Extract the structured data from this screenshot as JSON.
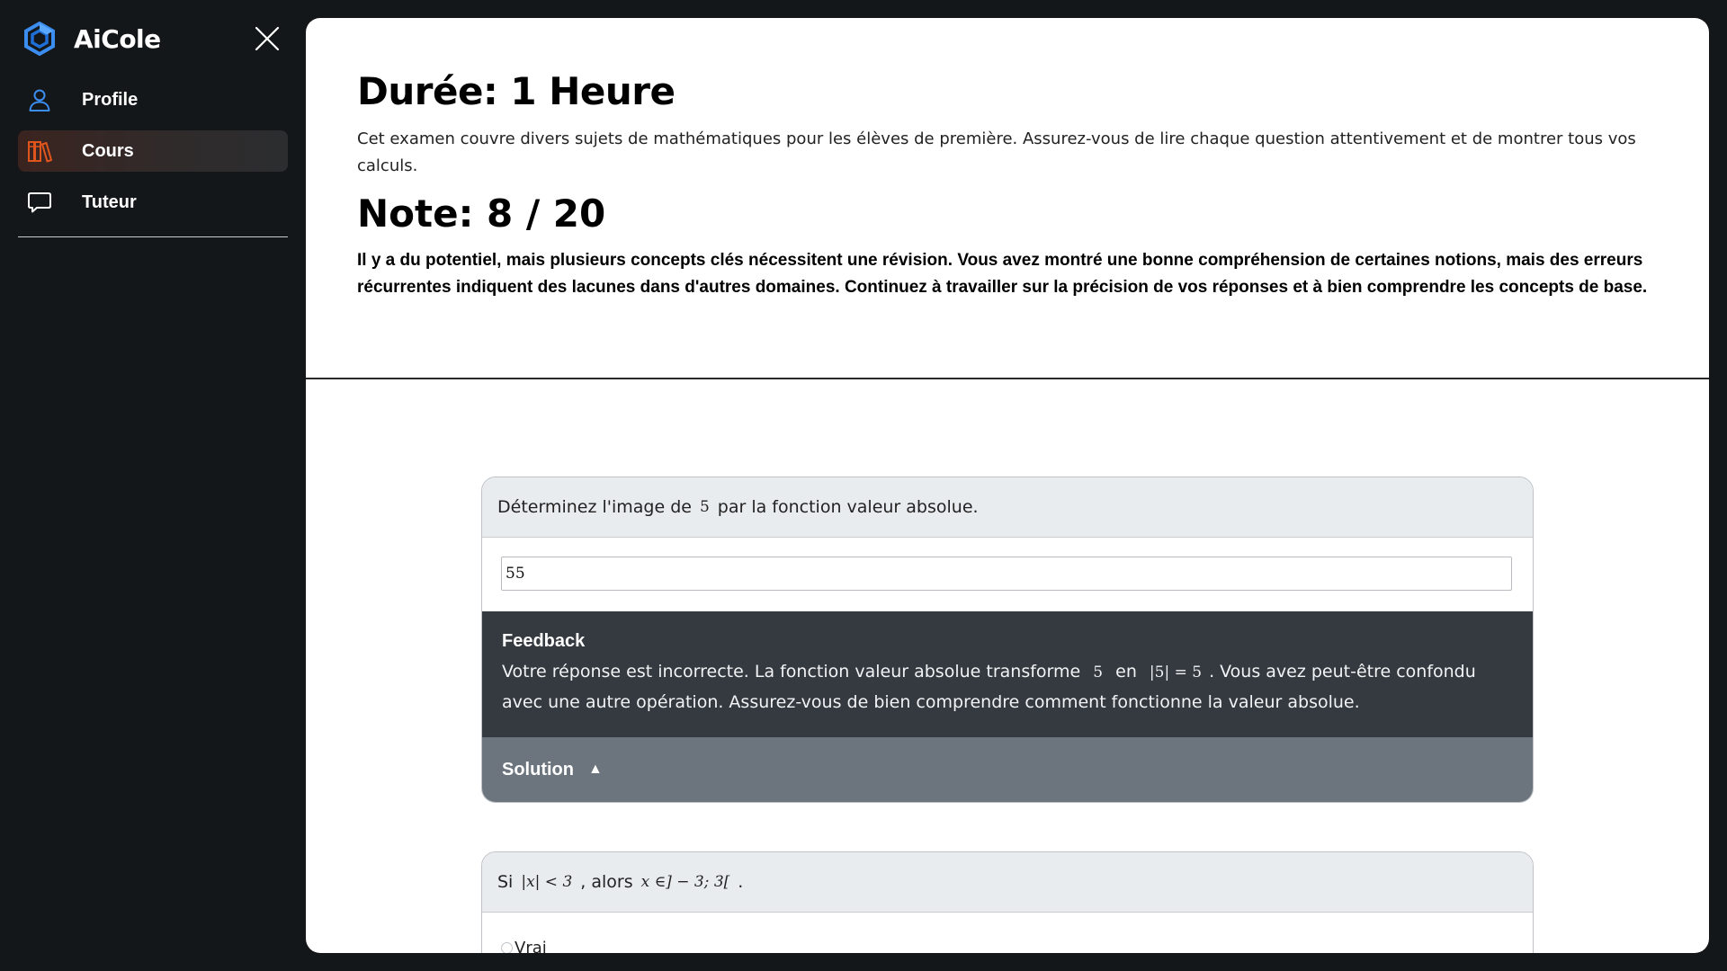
{
  "app": {
    "name": "AiCole"
  },
  "sidebar": {
    "items": [
      {
        "label": "Profile",
        "icon": "user-icon",
        "active": false
      },
      {
        "label": "Cours",
        "icon": "books-icon",
        "active": true
      },
      {
        "label": "Tuteur",
        "icon": "chat-icon",
        "active": false
      }
    ]
  },
  "exam": {
    "duration_title": "Durée: 1 Heure",
    "description": "Cet examen couvre divers sujets de mathématiques pour les élèves de première. Assurez-vous de lire chaque question attentivement et de montrer tous vos calculs.",
    "score_title": "Note: 8 / 20",
    "comment": "Il y a du potentiel, mais plusieurs concepts clés nécessitent une révision. Vous avez montré une bonne compréhension de certaines notions, mais des erreurs récurrentes indiquent des lacunes dans d'autres domaines. Continuez à travailler sur la précision de vos réponses et à bien comprendre les concepts de base."
  },
  "questions": [
    {
      "prompt_before": "Déterminez l'image de",
      "prompt_math": "5",
      "prompt_after": "par la fonction valeur absolue.",
      "answer": "55",
      "feedback": {
        "title": "Feedback",
        "text_1": "Votre réponse est incorrecte. La fonction valeur absolue transforme",
        "math_1": "5",
        "text_2": "en",
        "math_2": "|5| = 5",
        "text_3": ". Vous avez peut-être confondu avec une autre opération. Assurez-vous de bien comprendre comment fonctionne la valeur absolue."
      },
      "solution": {
        "label": "Solution",
        "arrow": "▲"
      }
    },
    {
      "prompt_before": "Si",
      "prompt_math": "|x| < 3",
      "prompt_middle": ", alors",
      "prompt_math_2": "x ∈] − 3; 3[",
      "prompt_after": ".",
      "option": "Vrai"
    }
  ],
  "colors": {
    "sidebar_bg": "#141719",
    "accent_blue": "#3b8ef0",
    "accent_orange": "#e0551c",
    "feedback_bg": "#343a40",
    "solution_bg": "#6c757d",
    "card_header_bg": "#e9ecef"
  }
}
